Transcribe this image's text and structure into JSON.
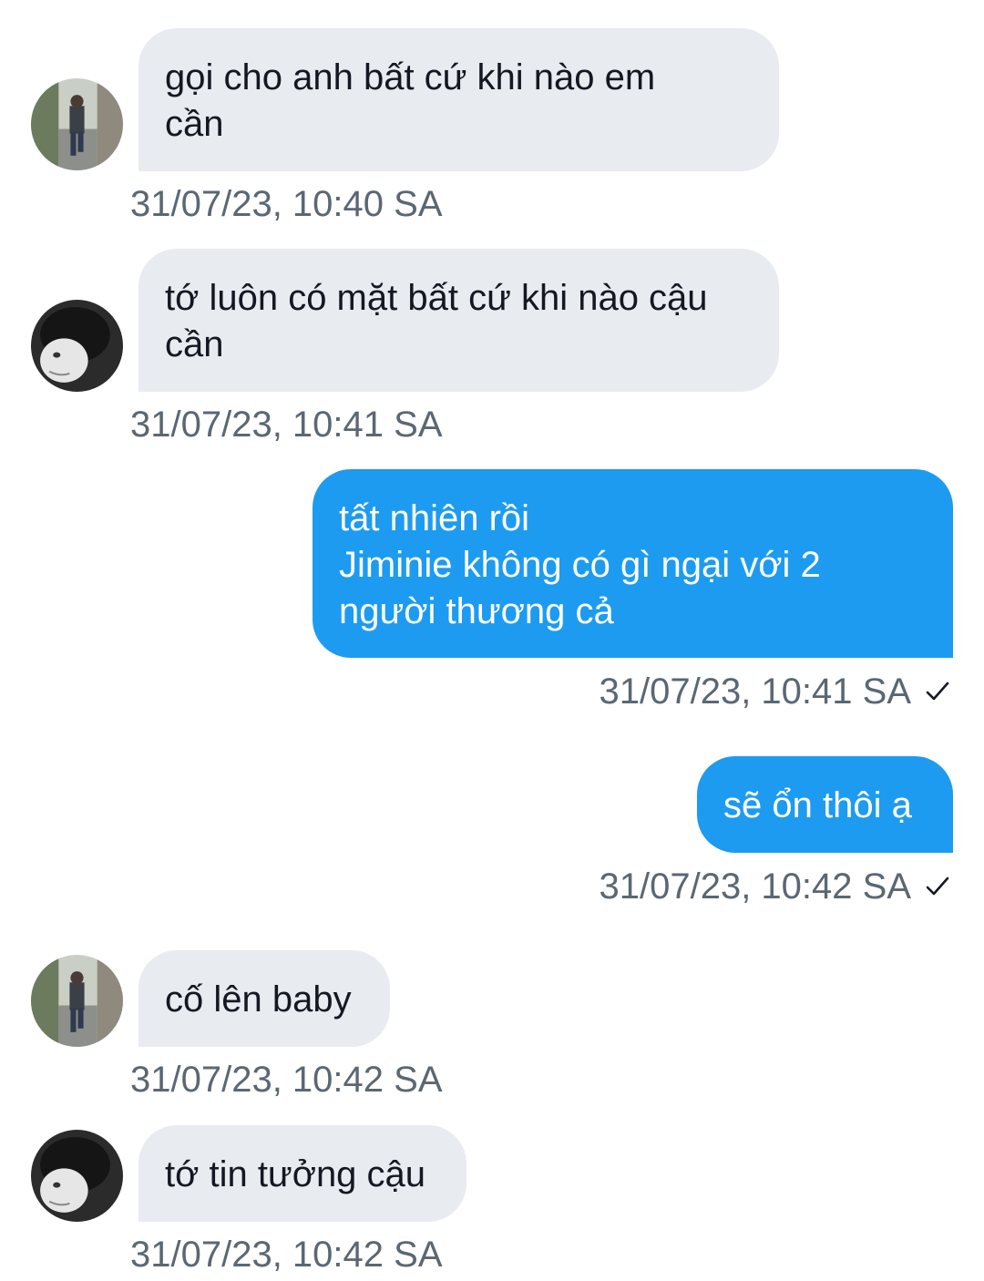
{
  "colors": {
    "received_bubble": "#e8ecf0",
    "sent_bubble": "#1d9bf0",
    "timestamp": "#5b6773"
  },
  "messages": [
    {
      "direction": "received",
      "avatar": "avatar-walking-street",
      "text": "gọi cho anh bất cứ khi nào em\ncần",
      "time": "31/07/23, 10:40 SA"
    },
    {
      "direction": "received",
      "avatar": "avatar-bw-portrait",
      "text": "tớ luôn có mặt bất cứ khi nào cậu\ncần",
      "time": "31/07/23, 10:41 SA"
    },
    {
      "direction": "sent",
      "text": "tất nhiên rồi\nJiminie không có gì ngại với 2\nngười thương cả",
      "time": "31/07/23, 10:41 SA",
      "status_icon": "check-icon"
    },
    {
      "direction": "sent",
      "text": "sẽ ổn thôi ạ",
      "time": "31/07/23, 10:42 SA",
      "status_icon": "check-icon"
    },
    {
      "direction": "received",
      "avatar": "avatar-walking-street",
      "text": "cố lên baby",
      "time": "31/07/23, 10:42 SA"
    },
    {
      "direction": "received",
      "avatar": "avatar-bw-portrait",
      "text": "tớ tin tưởng cậu",
      "time": "31/07/23, 10:42 SA"
    }
  ]
}
